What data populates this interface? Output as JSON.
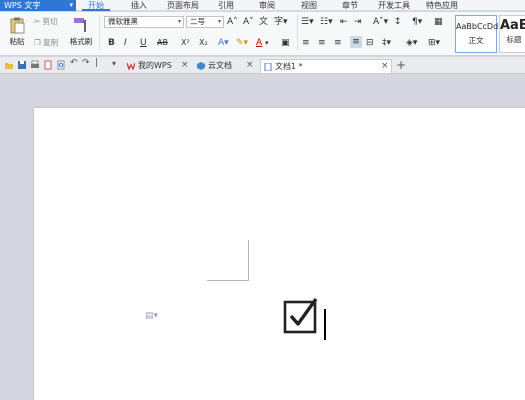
{
  "app": {
    "name": "WPS 文字",
    "drop": "▾"
  },
  "menu": {
    "tabs": [
      "开始",
      "插入",
      "页面布局",
      "引用",
      "审阅",
      "视图",
      "章节",
      "开发工具",
      "特色应用"
    ],
    "active": 0
  },
  "ribbon": {
    "paste_label": "粘贴",
    "cut_label": "剪切",
    "copy_label": "复制",
    "format_painter_label": "格式刷",
    "font_family": "微软雅黑",
    "font_size": "二号",
    "bold": "B",
    "italic": "I",
    "underline": "U",
    "strikethrough": "AB",
    "superscript": "X²",
    "subscript": "X₂",
    "font_color_glyph": "A",
    "styles": [
      {
        "sample": "AaBbCcDd",
        "name": "正文"
      },
      {
        "sample": "AaB",
        "name": "标题"
      }
    ]
  },
  "doc_tabs": [
    {
      "label": "我的WPS",
      "icon": "wps-logo-icon",
      "close": "×"
    },
    {
      "label": "云文档",
      "icon": "cloud-icon",
      "close": "×"
    },
    {
      "label": "文档1 *",
      "icon": "document-icon",
      "close": "×",
      "active": true
    }
  ],
  "new_tab": "+",
  "document": {
    "checkbox_glyph": "☑",
    "paste_options_glyph": "▾"
  },
  "colors": {
    "accent": "#2f77d5",
    "page": "#ffffff",
    "workspace": "#d6d7de"
  }
}
